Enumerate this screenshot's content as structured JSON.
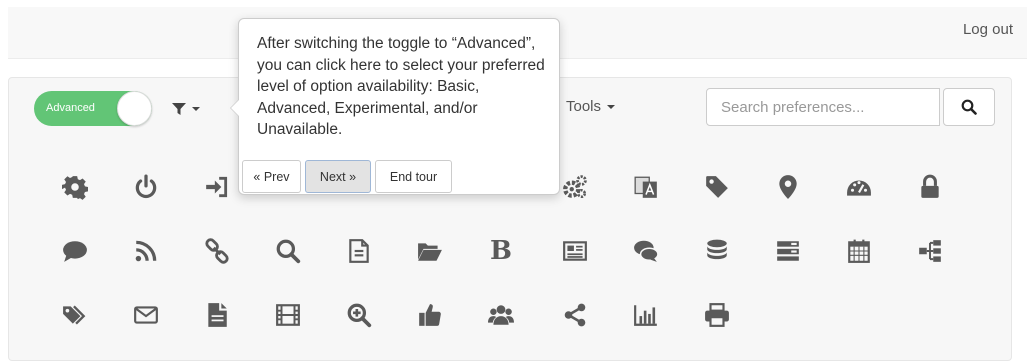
{
  "header": {
    "logout_label": "Log out"
  },
  "toolbar": {
    "toggle_label": "Advanced",
    "tools_label": "Tools",
    "search_placeholder": "Search preferences..."
  },
  "tour": {
    "text": "After switching the toggle to “Advanced”, you can click here to select your preferred level of option availability: Basic, Advanced, Experimental, and/or Unavailable.",
    "prev_label": "« Prev",
    "next_label": "Next »",
    "end_label": "End tour"
  },
  "icons": {
    "color": "#5a5a5a",
    "row1": [
      "gear-icon",
      "power-icon",
      "sign-in-icon",
      "gears-icon",
      "translate-icon",
      "tag-icon",
      "map-marker-icon",
      "dashboard-icon",
      "lock-icon"
    ],
    "row2": [
      "comment-icon",
      "rss-icon",
      "link-icon",
      "search-icon",
      "file-text-icon",
      "folder-open-icon",
      "bold-icon",
      "newspaper-icon",
      "comments-icon",
      "database-icon",
      "server-icon",
      "calendar-icon",
      "sitemap-icon"
    ],
    "row3": [
      "tags-icon",
      "envelope-icon",
      "file-icon",
      "film-icon",
      "zoom-in-icon",
      "thumbs-up-icon",
      "users-icon",
      "share-icon",
      "bar-chart-icon",
      "print-icon"
    ],
    "bold_glyph": "B"
  }
}
